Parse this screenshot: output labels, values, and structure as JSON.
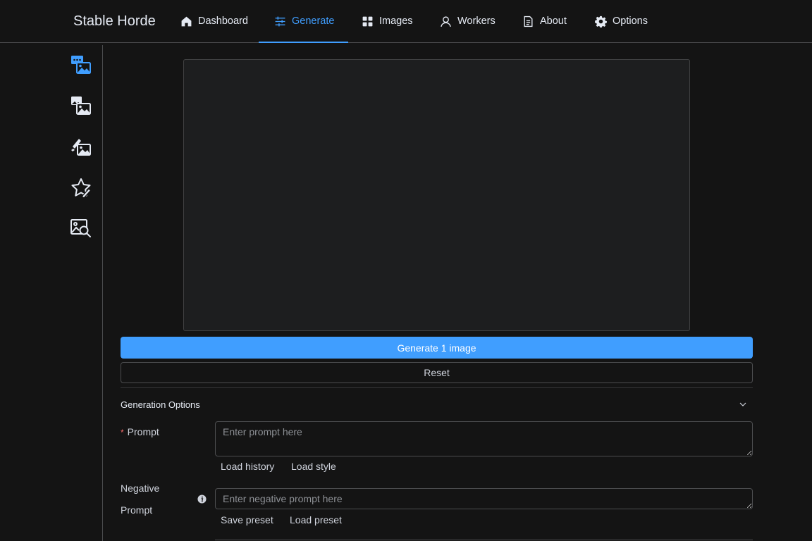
{
  "app": {
    "title": "Stable Horde"
  },
  "nav": {
    "dashboard": "Dashboard",
    "generate": "Generate",
    "images": "Images",
    "workers": "Workers",
    "about": "About",
    "options": "Options",
    "active": "Generate"
  },
  "sidebar": {
    "items": [
      {
        "icon": "text-to-image-icon"
      },
      {
        "icon": "image-to-image-icon"
      },
      {
        "icon": "inpainting-icon"
      },
      {
        "icon": "rating-star-icon"
      },
      {
        "icon": "image-interrogation-icon"
      }
    ]
  },
  "actions": {
    "generate_label": "Generate 1 image",
    "reset_label": "Reset"
  },
  "generation_options": {
    "title": "Generation Options",
    "prompt_label": "Prompt",
    "prompt_required_marker": "*",
    "prompt_value": "",
    "prompt_placeholder": "Enter prompt here",
    "load_history": "Load history",
    "load_style": "Load style",
    "negative_label_line1": "Negative",
    "negative_label_line2": "Prompt",
    "negative_value": "",
    "negative_placeholder": "Enter negative prompt here",
    "save_preset": "Save preset",
    "load_preset": "Load preset"
  },
  "colors": {
    "accent": "#409eff",
    "background": "#141414",
    "required": "#f56c6c"
  }
}
